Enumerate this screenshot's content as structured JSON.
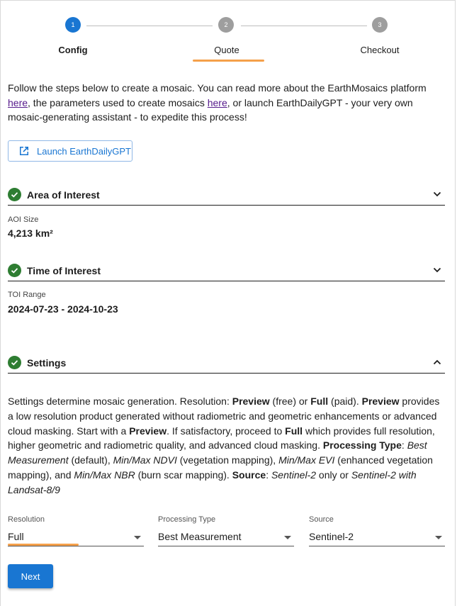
{
  "stepper": {
    "steps": [
      {
        "number": "1",
        "label": "Config"
      },
      {
        "number": "2",
        "label": "Quote"
      },
      {
        "number": "3",
        "label": "Checkout"
      }
    ]
  },
  "intro": {
    "text1": "Follow the steps below to create a mosaic. You can read more about the EarthMosaics platform ",
    "link1": "here",
    "text2": ", the parameters used to create mosaics ",
    "link2": "here",
    "text3": ", or launch EarthDailyGPT - your very own mosaic-generating assistant - to expedite this process!"
  },
  "launch_button": {
    "label": "Launch EarthDailyGPT",
    "icon": "open-in-new-icon"
  },
  "aoi": {
    "title": "Area of Interest",
    "label": "AOI Size",
    "value": "4,213 km²"
  },
  "toi": {
    "title": "Time of Interest",
    "label": "TOI Range",
    "value": "2024-07-23 - 2024-10-23"
  },
  "settings": {
    "title": "Settings",
    "desc": [
      {
        "t": "Settings determine mosaic generation. Resolution: ",
        "s": "n"
      },
      {
        "t": "Preview",
        "s": "b"
      },
      {
        "t": " (free) or ",
        "s": "n"
      },
      {
        "t": "Full",
        "s": "b"
      },
      {
        "t": " (paid). ",
        "s": "n"
      },
      {
        "t": "Preview",
        "s": "b"
      },
      {
        "t": " provides a low resolution product generated without radiometric and geometric enhancements or advanced cloud masking. Start with a ",
        "s": "n"
      },
      {
        "t": "Preview",
        "s": "b"
      },
      {
        "t": ". If satisfactory, proceed to ",
        "s": "n"
      },
      {
        "t": "Full",
        "s": "b"
      },
      {
        "t": " which provides full resolution, higher geometric and radiometric quality, and advanced cloud masking. ",
        "s": "n"
      },
      {
        "t": "Processing Type",
        "s": "b"
      },
      {
        "t": ": ",
        "s": "n"
      },
      {
        "t": "Best Measurement",
        "s": "i"
      },
      {
        "t": " (default), ",
        "s": "n"
      },
      {
        "t": "Min/Max NDVI",
        "s": "i"
      },
      {
        "t": " (vegetation mapping), ",
        "s": "n"
      },
      {
        "t": "Min/Max EVI",
        "s": "i"
      },
      {
        "t": " (enhanced vegetation mapping), and ",
        "s": "n"
      },
      {
        "t": "Min/Max NBR",
        "s": "i"
      },
      {
        "t": " (burn scar mapping). ",
        "s": "n"
      },
      {
        "t": "Source",
        "s": "b"
      },
      {
        "t": ": ",
        "s": "n"
      },
      {
        "t": "Sentinel-2",
        "s": "i"
      },
      {
        "t": " only or ",
        "s": "n"
      },
      {
        "t": "Sentinel-2 with Landsat-8/9",
        "s": "i"
      }
    ],
    "fields": {
      "resolution": {
        "label": "Resolution",
        "value": "Full"
      },
      "processing": {
        "label": "Processing Type",
        "value": "Best Measurement"
      },
      "source": {
        "label": "Source",
        "value": "Sentinel-2"
      }
    }
  },
  "next_button": {
    "label": "Next"
  },
  "colors": {
    "primary": "#1976d2",
    "accent_underline": "#f5a04a",
    "success": "#2e7d32",
    "inactive_step": "#9e9e9e"
  }
}
